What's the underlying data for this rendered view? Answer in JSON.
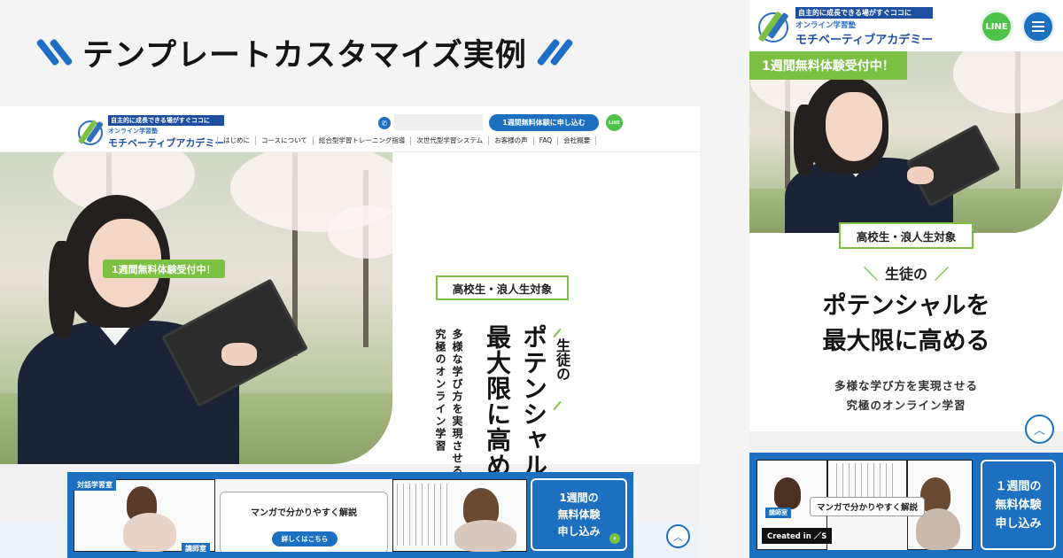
{
  "heading": {
    "title": "テンプレートカスタマイズ実例"
  },
  "site": {
    "logo_tagline": "自主的に成長できる場がすぐココに",
    "logo_subtitle": "オンライン学習塾",
    "logo_name": "モチベーティブアカデミー"
  },
  "desktop": {
    "header": {
      "cta_label": "1週間無料体験に申し込む",
      "line_label": "LINE",
      "nav": [
        "はじめに",
        "コースについて",
        "総合型学習トレーニング指導",
        "次世代型学習システム",
        "お客様の声",
        "FAQ",
        "会社概要"
      ]
    },
    "hero": {
      "free_badge": "1週間無料体験受付中！",
      "target": "高校生・浪人生対象",
      "catch_small": "生徒の",
      "catch_line1": "ポテンシャルを",
      "catch_line2": "最大限に高める",
      "desc_line1": "多様な学び方を実現させる",
      "desc_line2": "究極のオンライン学習"
    },
    "manga": {
      "label_top": "対話学習室",
      "label_bottom": "講師室",
      "title": "マンガで分かりやすく解説",
      "button": "詳しくはこちら"
    },
    "trial": {
      "line1": "1週間の",
      "line2": "無料体験",
      "line3": "申し込み"
    }
  },
  "mobile": {
    "header": {
      "line_label": "LINE"
    },
    "hero": {
      "free_badge": "1週間無料体験受付中！",
      "target": "高校生・浪人生対象",
      "catch_small": "生徒の",
      "catch_line1": "ポテンシャルを",
      "catch_line2": "最大限に高める",
      "desc_line1": "多様な学び方を実現させる",
      "desc_line2": "究極のオンライン学習"
    },
    "manga": {
      "label": "講師室",
      "caption": "マンガで分かりやすく解説",
      "created_in": "Created in ／S"
    },
    "trial": {
      "line1": "１週間の",
      "line2": "無料体験",
      "line3": "申し込み"
    }
  },
  "colors": {
    "brand_blue": "#1d6fc0",
    "accent_green": "#7cc043",
    "line_green": "#4cc24b"
  }
}
